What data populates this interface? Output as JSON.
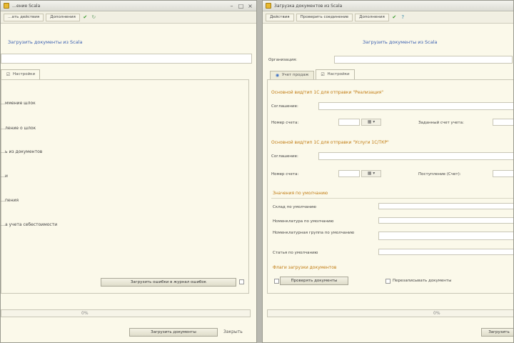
{
  "left_window": {
    "title": "…ение Scala",
    "toolbar": {
      "button1": "…ать действия",
      "button2": "Дополнения"
    },
    "link_title": "Загрузить документы из Scala",
    "tab": "Настройки",
    "items": [
      "…ммение шлок",
      "…ление о шлок",
      "…ь из документов",
      "…и",
      "…пения",
      "…а учета себестоимости"
    ],
    "action_button": "Загрузить ошибки в журнал ошибок",
    "progress_percent": "0%",
    "load_button": "Загрузить документы",
    "close_link": "Закрыть"
  },
  "right_window": {
    "title": "Загрузка документов из Scala",
    "toolbar": {
      "button1": "Действия",
      "button2": "Проверить соединение",
      "button3": "Дополнения"
    },
    "link_title": "Загрузить документы из Scala",
    "org_label": "Организация:",
    "tabs": [
      "Учет продаж",
      "Настройки"
    ],
    "section1": "Основной вид/тип 1С для отправки \"Реализация\"",
    "section1_fields": {
      "label1": "Соглашение:",
      "label2": "Номер счета:",
      "label3": "Заданный счет учета:"
    },
    "section2": "Основной вид/тип 1С для отправки \"Услуги 1С/ТКР\"",
    "section2_fields": {
      "label1": "Соглашение:",
      "label2": "Номер счета:",
      "label3": "Поступление (Счет):"
    },
    "section3": "Значения по умолчанию",
    "defaults": [
      "Склад по умолчанию",
      "Номенклатура по умолчанию",
      "Номенклатурная группа по умолчанию",
      "Статья по умолчанию"
    ],
    "section4": "Флаги загрузки документов",
    "checkbox1": "Проверять документы",
    "checkbox2": "Перезаписывать документы",
    "progress_percent": "0%",
    "load_button": "Загрузить"
  }
}
